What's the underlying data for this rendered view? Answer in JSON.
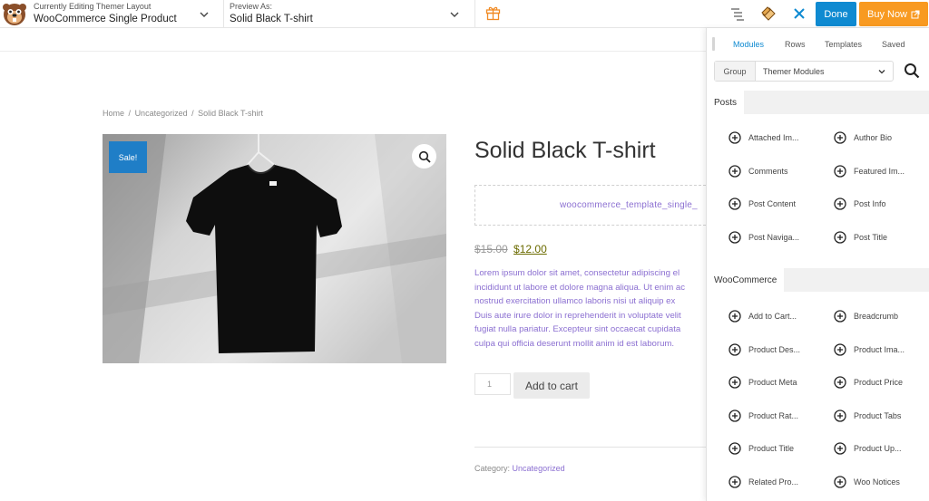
{
  "topbar": {
    "layout_label": "Currently Editing Themer Layout",
    "layout_value": "WooCommerce Single Product",
    "preview_label": "Preview As:",
    "preview_value": "Solid Black T-shirt",
    "done_label": "Done",
    "buy_label": "Buy Now"
  },
  "breadcrumb": {
    "home": "Home",
    "category": "Uncategorized",
    "current": "Solid Black T-shirt",
    "separator": "/"
  },
  "product": {
    "sale_badge": "Sale!",
    "title": "Solid Black T-shirt",
    "shortcode": "woocommerce_template_single_",
    "old_price": "$15.00",
    "new_price": "$12.00",
    "description_lines": [
      "Lorem ipsum dolor sit amet, consectetur adipiscing el",
      "incididunt ut labore et dolore magna aliqua. Ut enim ac",
      "nostrud exercitation ullamco laboris nisi ut aliquip ex",
      "Duis aute irure dolor in reprehenderit in voluptate velit",
      "fugiat nulla pariatur. Excepteur sint occaecat cupidata",
      "culpa qui officia deserunt mollit anim id est laborum."
    ],
    "quantity": "1",
    "add_to_cart": "Add to cart",
    "category_label": "Category:",
    "category_value": "Uncategorized"
  },
  "panel": {
    "tabs": [
      "Modules",
      "Rows",
      "Templates",
      "Saved"
    ],
    "group_label": "Group",
    "group_value": "Themer Modules",
    "sections": [
      {
        "title": "Posts",
        "modules": [
          "Attached Im...",
          "Author Bio",
          "Comments",
          "Featured Im...",
          "Post Content",
          "Post Info",
          "Post Naviga...",
          "Post Title"
        ]
      },
      {
        "title": "WooCommerce",
        "modules": [
          "Add to Cart...",
          "Breadcrumb",
          "Product Des...",
          "Product Ima...",
          "Product Meta",
          "Product Price",
          "Product Rat...",
          "Product Tabs",
          "Product Title",
          "Product Up...",
          "Related Pro...",
          "Woo Notices"
        ]
      }
    ]
  },
  "colors": {
    "done_blue": "#0f8ad1",
    "buy_orange": "#f89a21",
    "sale_blue": "#1f7ec7",
    "link_purple": "#8b6fd1"
  }
}
